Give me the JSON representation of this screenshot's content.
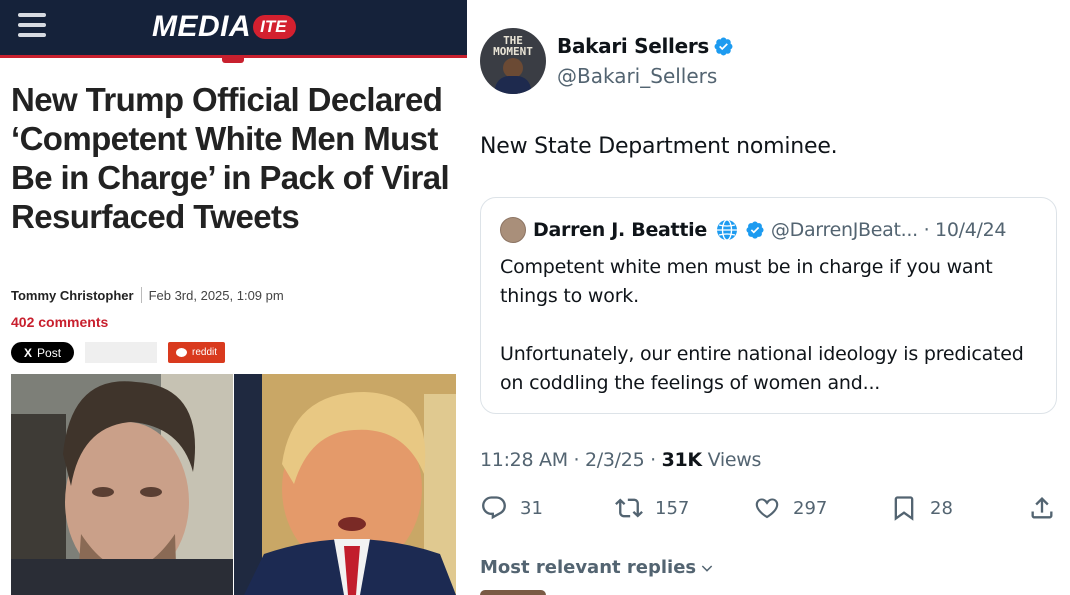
{
  "article": {
    "site_logo_main": "MEDIA",
    "site_logo_suffix": "ITE",
    "headline": "New Trump Official Declared ‘Competent White Men Must Be in Charge’ in Pack of Viral Resurfaced Tweets",
    "author": "Tommy Christopher",
    "date": "Feb 3rd, 2025, 1:09 pm",
    "comments": "402 comments",
    "share": {
      "x_logo": "X",
      "x_label": "Post",
      "reddit_label": "reddit"
    },
    "icons": [
      "hamburger-menu-icon",
      "x-logo-icon",
      "reddit-icon"
    ],
    "colors": {
      "navy": "#15223a",
      "brand_red": "#c8202e"
    }
  },
  "tweet": {
    "author_name": "Bakari Sellers",
    "author_handle": "@Bakari_Sellers",
    "avatar_text": "THE\nMOMENT",
    "text": "New State Department nominee.",
    "quote": {
      "name": "Darren J. Beattie",
      "meta": "@DarrenJBeat... · 10/4/24",
      "paragraphs": [
        "Competent white men must be in charge if you want things to work.",
        "Unfortunately, our entire national ideology is predicated on coddling the feelings of women and..."
      ]
    },
    "time": "11:28 AM · 2/3/25 · ",
    "views_count": "31K",
    "views_label": " Views",
    "actions": {
      "replies": "31",
      "reposts": "157",
      "likes": "297",
      "bookmarks": "28"
    },
    "relevant_label": "Most relevant replies",
    "icons": [
      "verified-badge-icon",
      "globe-icon",
      "reply-icon",
      "repost-icon",
      "like-icon",
      "bookmark-icon",
      "share-icon",
      "chevron-down-icon"
    ],
    "colors": {
      "verified_blue": "#1d9bf0",
      "text": "#0f1419",
      "muted": "#536471"
    }
  }
}
